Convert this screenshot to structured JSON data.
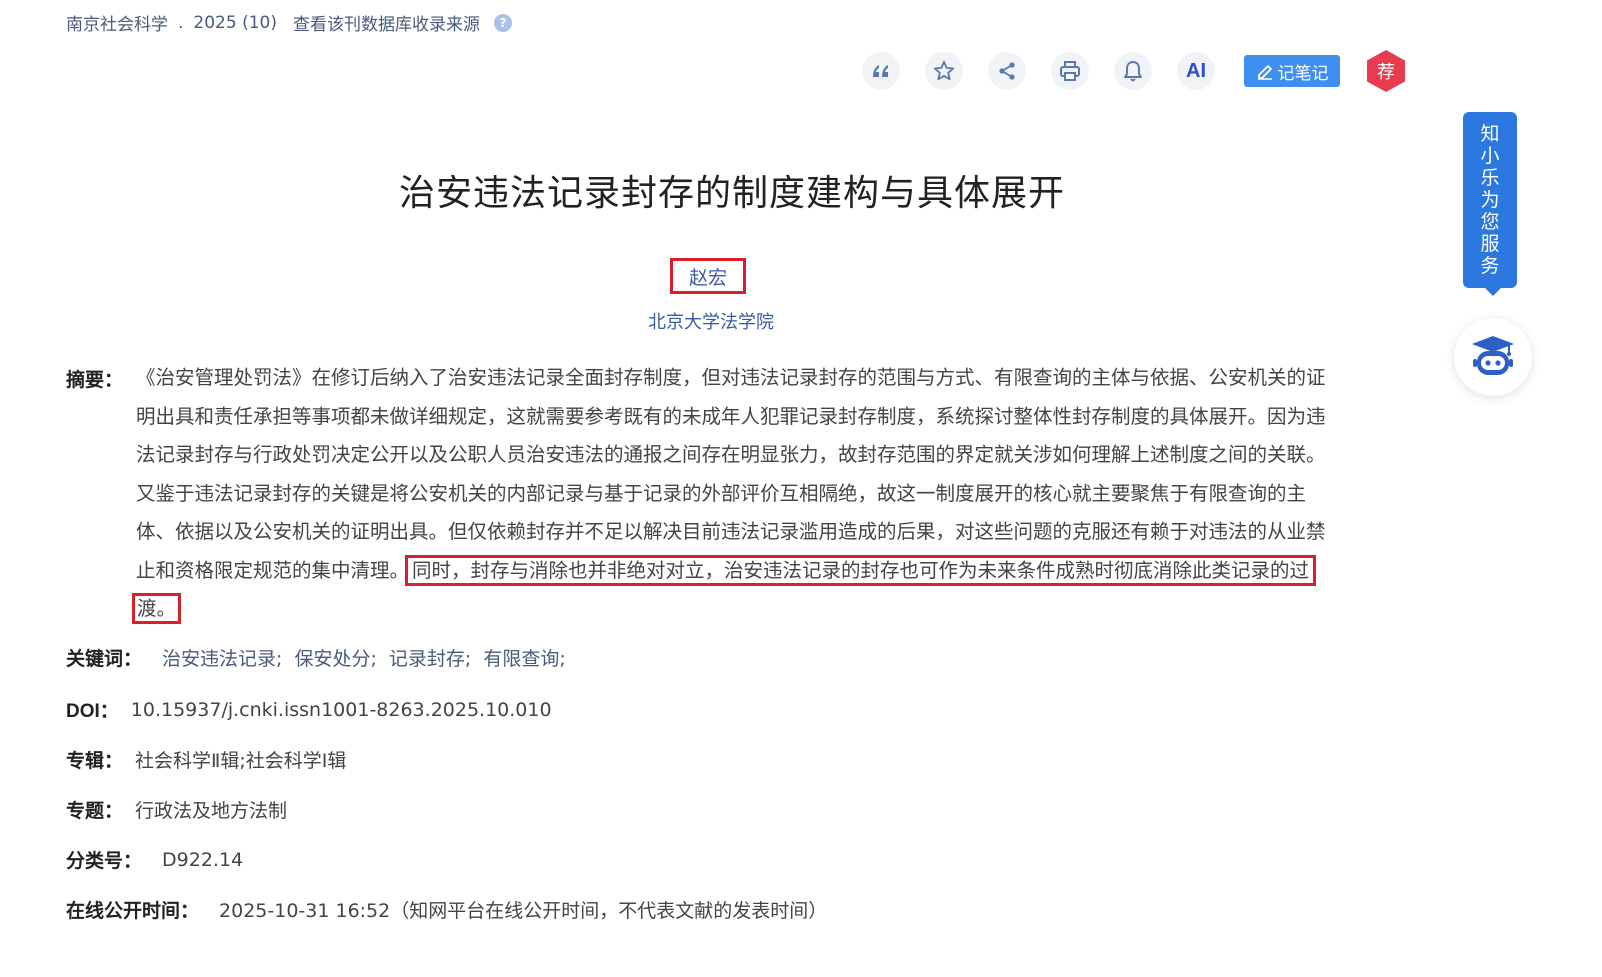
{
  "source": {
    "journal": "南京社会科学",
    "issue": "2025 (10)",
    "link": "查看该刊数据库收录来源",
    "help_glyph": "?"
  },
  "toolbar": {
    "items": [
      "quote-icon",
      "star-icon",
      "share-icon",
      "print-icon",
      "bell-icon"
    ],
    "ai_label": "AI",
    "note_label": "记笔记",
    "rec_label": "荐"
  },
  "title": "治安违法记录封存的制度建构与具体展开",
  "author": "赵宏",
  "affiliation": "北京大学法学院",
  "abstract": {
    "label": "摘要：",
    "lines": [
      "《治安管理处罚法》在修订后纳入了治安违法记录全面封存制度，但对违法记录封存的范围与方式、有限查询的主体与依据、公安机关的证",
      "明出具和责任承担等事项都未做详细规定，这就需要参考既有的未成年人犯罪记录封存制度，系统探讨整体性封存制度的具体展开。因为违",
      "法记录封存与行政处罚决定公开以及公职人员治安违法的通报之间存在明显张力，故封存范围的界定就关涉如何理解上述制度之间的关联。",
      "又鉴于违法记录封存的关键是将公安机关的内部记录与基于记录的外部评价互相隔绝，故这一制度展开的核心就主要聚焦于有限查询的主",
      "体、依据以及公安机关的证明出具。但仅依赖封存并不足以解决目前违法记录滥用造成的后果，对这些问题的克服还有赖于对违法的从业禁"
    ],
    "line6_plain": "止和资格限定规范的集中清理。",
    "line6_highlight": "同时，封存与消除也并非绝对对立，治安违法记录的封存也可作为未来条件成熟时彻底消除此类记录的过",
    "line7_highlight": "渡。"
  },
  "keywords": {
    "label": "关键词：",
    "items": [
      "治安违法记录;",
      "保安处分;",
      "记录封存;",
      "有限查询;"
    ]
  },
  "doi": {
    "label": "DOI：",
    "value": "10.15937/j.cnki.issn1001-8263.2025.10.010"
  },
  "album": {
    "label": "专辑：",
    "value": "社会科学Ⅱ辑;社会科学Ⅰ辑"
  },
  "topic": {
    "label": "专题：",
    "value": "行政法及地方法制"
  },
  "classification": {
    "label": "分类号：",
    "value": "D922.14"
  },
  "online_time": {
    "label": "在线公开时间：",
    "value": "2025-10-31 16:52（知网平台在线公开时间，不代表文献的发表时间）"
  },
  "assistant": {
    "banner_chars": [
      "知",
      "小",
      "乐",
      "为",
      "您",
      "服",
      "务"
    ]
  }
}
